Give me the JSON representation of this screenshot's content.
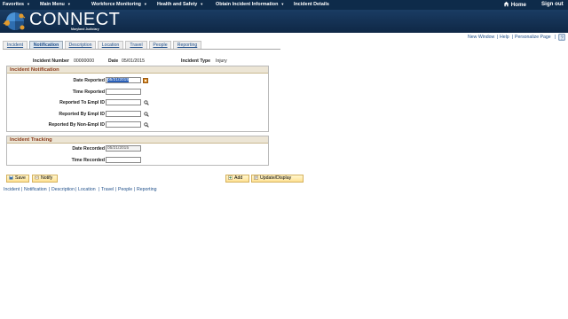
{
  "topnav": {
    "items": [
      "Favorites",
      "Main Menu",
      "Workforce Monitoring",
      "Health and Safety",
      "Obtain Incident Information",
      "Incident Details"
    ],
    "home": "Home",
    "signout": "Sign out"
  },
  "banner": {
    "logo_text": "CONNECT",
    "logo_sub": "Maryland Judiciary"
  },
  "tabs": [
    "Incident",
    "Notification",
    "Description",
    "Location",
    "Travel",
    "People",
    "Reporting"
  ],
  "utility": {
    "new_window": "New Window",
    "help": "Help",
    "personalize": "Personalize Page",
    "sep": "|"
  },
  "incident": {
    "number_label": "Incident Number",
    "number_value": "00000000",
    "date_label": "Date",
    "date_value": "05/01/2015",
    "type_label": "Incident Type",
    "type_value": "Injury"
  },
  "notification": {
    "header": "Incident Notification",
    "date_reported_label": "Date Reported",
    "date_reported_value": "05/21/2015",
    "time_reported_label": "Time Reported",
    "time_reported_value": "",
    "to_empl_label": "Reported To Empl ID",
    "to_empl_value": "",
    "by_empl_label": "Reported By Empl ID",
    "by_empl_value": "",
    "by_nonempl_label": "Reported By Non-Empl ID",
    "by_nonempl_value": ""
  },
  "tracking": {
    "header": "Incident Tracking",
    "date_recorded_label": "Date Recorded",
    "date_recorded_value": "05/21/2015",
    "time_recorded_label": "Time Recorded",
    "time_recorded_value": ""
  },
  "buttons": {
    "save": "Save",
    "notify": "Notify",
    "add": "Add",
    "update": "Update/Display"
  },
  "bottom_links": [
    "Incident",
    "Notification",
    "Description",
    "Location",
    "Travel",
    "People",
    "Reporting"
  ],
  "colors": {
    "nav_bg": "#0e2b4a",
    "section_header": "#8a3d1e",
    "link": "#1f4f8a",
    "button": "#ffe194"
  }
}
